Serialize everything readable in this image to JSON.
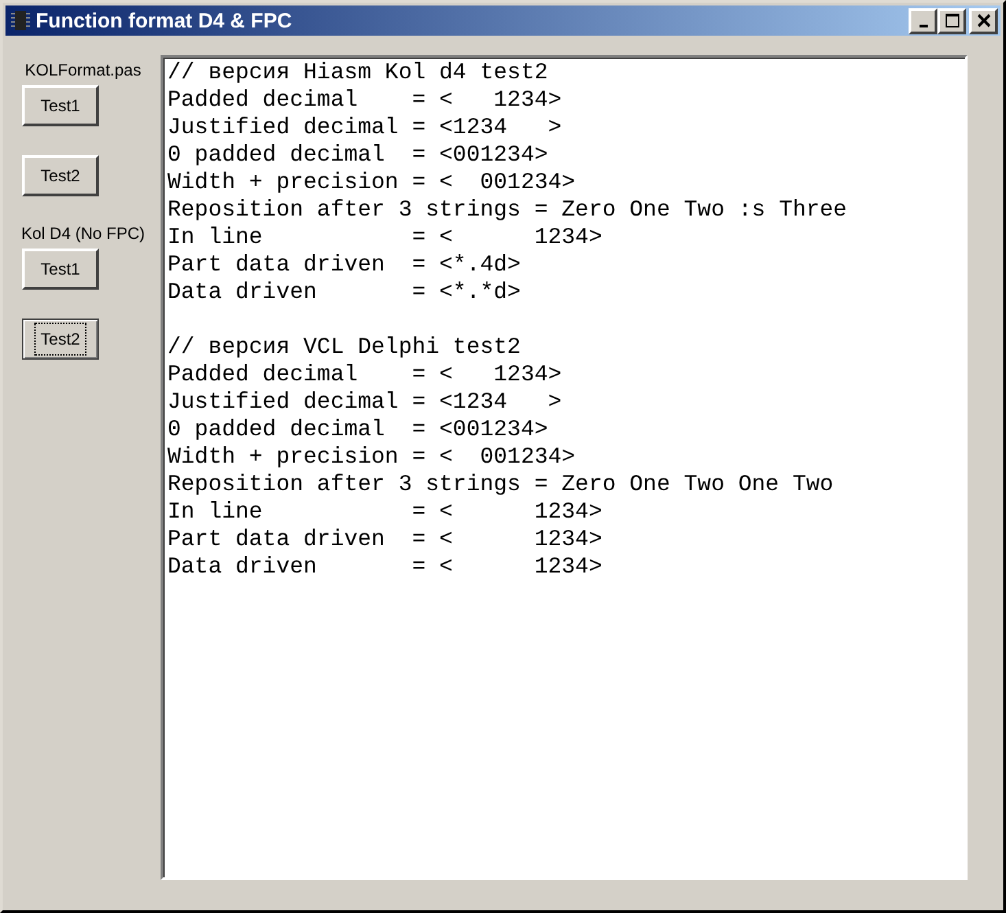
{
  "window": {
    "title": "Function format D4 & FPC"
  },
  "groups": [
    {
      "label": "KOLFormat.pas",
      "buttons": [
        {
          "label": "Test1",
          "focused": false
        },
        {
          "label": "Test2",
          "focused": false
        }
      ]
    },
    {
      "label": "Kol D4 (No FPC)",
      "buttons": [
        {
          "label": "Test1",
          "focused": false
        },
        {
          "label": "Test2",
          "focused": true
        }
      ]
    }
  ],
  "memo": {
    "blocks": [
      [
        "// версия Hiasm Kol d4 test2",
        "Padded decimal    = <   1234>",
        "Justified decimal = <1234   >",
        "0 padded decimal  = <001234>",
        "Width + precision = <  001234>",
        "Reposition after 3 strings = Zero One Two :s Three",
        "In line           = <      1234>",
        "Part data driven  = <*.4d>",
        "Data driven       = <*.*d>"
      ],
      [
        "// версия VCL Delphi test2",
        "Padded decimal    = <   1234>",
        "Justified decimal = <1234   >",
        "0 padded decimal  = <001234>",
        "Width + precision = <  001234>",
        "Reposition after 3 strings = Zero One Two One Two",
        "In line           = <      1234>",
        "Part data driven  = <      1234>",
        "Data driven       = <      1234>"
      ]
    ]
  }
}
